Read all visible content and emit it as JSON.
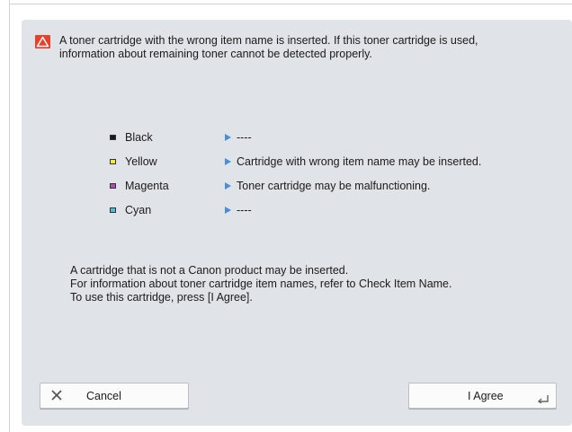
{
  "dialog": {
    "message_line1": "A toner cartridge with the wrong item name is inserted. If this toner cartridge is used,",
    "message_line2": "information about remaining toner cannot be detected properly.",
    "warning_icon": "warning-triangle-icon",
    "accent_color": "#e8402a"
  },
  "cartridges": [
    {
      "name": "Black",
      "color": "#1a1a1a",
      "status": "----"
    },
    {
      "name": "Yellow",
      "color": "#f4ea3a",
      "status": "Cartridge with wrong item name may be inserted."
    },
    {
      "name": "Magenta",
      "color": "#b04fb6",
      "status": "Toner cartridge may be malfunctioning."
    },
    {
      "name": "Cyan",
      "color": "#4cc0d8",
      "status": "----"
    }
  ],
  "info": {
    "line1": "A cartridge that is not a Canon product may be inserted.",
    "line2": "For information about toner cartridge item names, refer to Check Item Name.",
    "line3": "To use this cartridge, press [I Agree]."
  },
  "buttons": {
    "cancel_label": "Cancel",
    "agree_label": "I Agree"
  }
}
